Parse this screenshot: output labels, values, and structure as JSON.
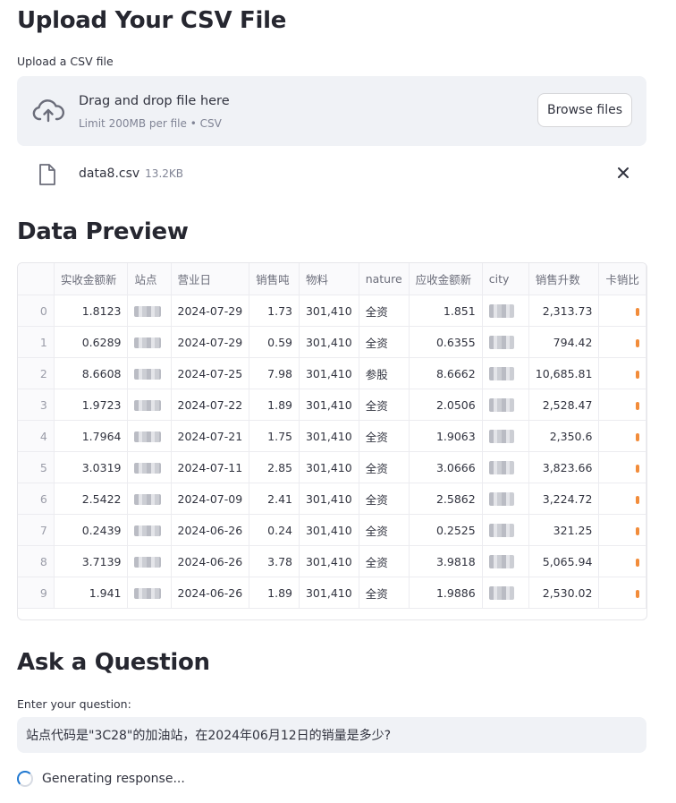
{
  "upload": {
    "heading": "Upload Your CSV File",
    "label": "Upload a CSV file",
    "drop_text": "Drag and drop file here",
    "limit_text": "Limit 200MB per file • CSV",
    "browse_label": "Browse files",
    "file": {
      "name": "data8.csv",
      "size": "13.2KB"
    }
  },
  "preview": {
    "heading": "Data Preview",
    "columns": [
      "",
      "实收金额新",
      "站点",
      "营业日",
      "销售吨",
      "物料",
      "nature",
      "应收金额新",
      "city",
      "销售升数",
      "卡销比"
    ],
    "rows": [
      [
        "0",
        "1.8123",
        "",
        "2024-07-29",
        "1.73",
        "301,410",
        "全资",
        "1.851",
        "",
        "2,313.73"
      ],
      [
        "1",
        "0.6289",
        "",
        "2024-07-29",
        "0.59",
        "301,410",
        "全资",
        "0.6355",
        "",
        "794.42"
      ],
      [
        "2",
        "8.6608",
        "",
        "2024-07-25",
        "7.98",
        "301,410",
        "参股",
        "8.6662",
        "",
        "10,685.81"
      ],
      [
        "3",
        "1.9723",
        "",
        "2024-07-22",
        "1.89",
        "301,410",
        "全资",
        "2.0506",
        "",
        "2,528.47"
      ],
      [
        "4",
        "1.7964",
        "",
        "2024-07-21",
        "1.75",
        "301,410",
        "全资",
        "1.9063",
        "",
        "2,350.6"
      ],
      [
        "5",
        "3.0319",
        "",
        "2024-07-11",
        "2.85",
        "301,410",
        "全资",
        "3.0666",
        "",
        "3,823.66"
      ],
      [
        "6",
        "2.5422",
        "",
        "2024-07-09",
        "2.41",
        "301,410",
        "全资",
        "2.5862",
        "",
        "3,224.72"
      ],
      [
        "7",
        "0.2439",
        "",
        "2024-06-26",
        "0.24",
        "301,410",
        "全资",
        "0.2525",
        "",
        "321.25"
      ],
      [
        "8",
        "3.7139",
        "",
        "2024-06-26",
        "3.78",
        "301,410",
        "全资",
        "3.9818",
        "",
        "5,065.94"
      ],
      [
        "9",
        "1.941",
        "",
        "2024-06-26",
        "1.89",
        "301,410",
        "全资",
        "1.9886",
        "",
        "2,530.02"
      ]
    ]
  },
  "ask": {
    "heading": "Ask a Question",
    "label": "Enter your question:",
    "question_value": "站点代码是\"3C28\"的加油站，在2024年06月12日的销量是多少?",
    "status_text": "Generating response..."
  },
  "icons": {
    "upload": "cloud-upload-icon",
    "file": "file-icon",
    "close": "close-icon",
    "spinner": "spinner-icon"
  },
  "colors": {
    "accent": "#1f77d0",
    "surface": "#f0f2f6",
    "text": "#31333f",
    "muted": "#808495"
  }
}
